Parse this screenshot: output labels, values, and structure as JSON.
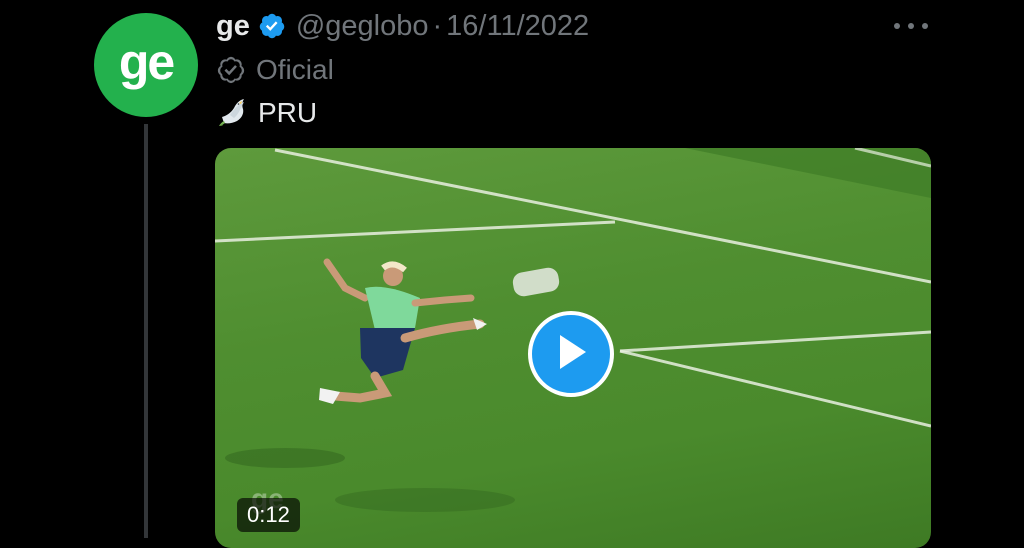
{
  "tweet": {
    "author": {
      "avatar_text": "ge",
      "name": "ge",
      "handle": "@geglobo",
      "separator": "·",
      "date": "16/11/2022",
      "affiliation": "Oficial",
      "avatar_color": "#23b14d",
      "verified_color": "#1d9bf0"
    },
    "text": "PRU",
    "text_emoji": "dove-icon",
    "media": {
      "type": "video",
      "duration": "0:12",
      "play_icon": "play-icon",
      "watermark": "ge"
    }
  },
  "colors": {
    "background": "#000000",
    "primary_text": "#e7e9ea",
    "secondary_text": "#71767b",
    "accent": "#1d9bf0"
  }
}
